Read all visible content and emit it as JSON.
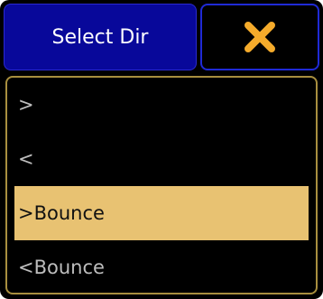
{
  "dialog": {
    "title": "Select Dir",
    "close_icon": "close-icon",
    "accent_color": "#08089a",
    "close_color": "#f5ab2b"
  },
  "options": [
    {
      "label": ">",
      "selected": false
    },
    {
      "label": "<",
      "selected": false
    },
    {
      "label": ">Bounce",
      "selected": true
    },
    {
      "label": "<Bounce",
      "selected": false
    }
  ],
  "colors": {
    "selection": "#e8c272",
    "frame": "#a88f3f",
    "text": "#bdbdbd"
  }
}
